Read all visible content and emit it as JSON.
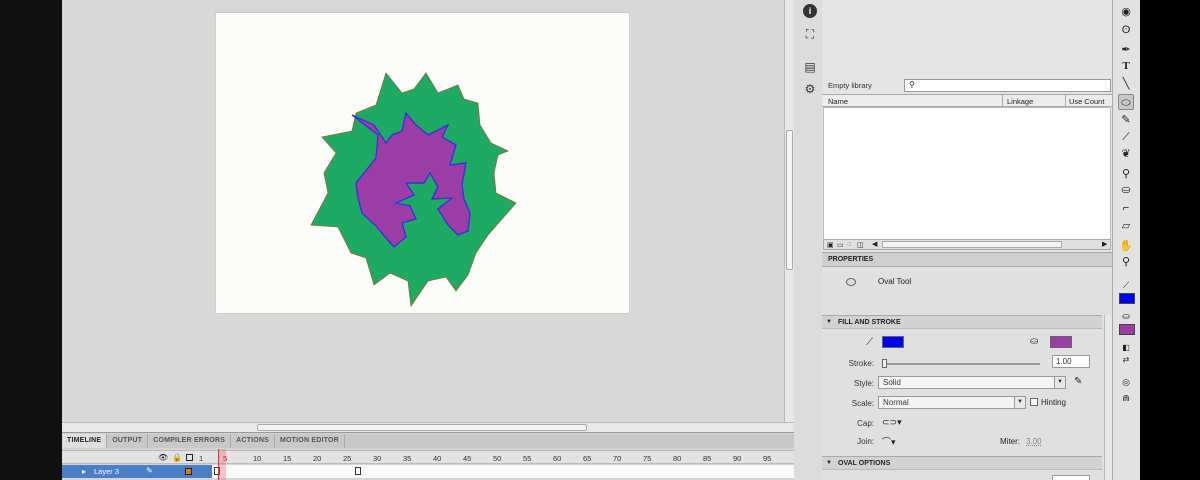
{
  "library": {
    "title": "Empty library",
    "search_value": "",
    "columns": [
      "Name",
      "Linkage",
      "Use Count"
    ]
  },
  "properties": {
    "tab_label": "PROPERTIES",
    "tool_name": "Oval Tool",
    "fill_stroke": {
      "title": "FILL AND STROKE",
      "stroke_color": "#0000ee",
      "fill_color": "#9a3ea3",
      "stroke_label": "Stroke:",
      "stroke_value": "1.00",
      "style_label": "Style:",
      "style_value": "Solid",
      "scale_label": "Scale:",
      "scale_value": "Normal",
      "hinting_label": "Hinting",
      "cap_label": "Cap:",
      "join_label": "Join:",
      "miter_label": "Miter:",
      "miter_value": "3.00"
    },
    "oval_options": {
      "title": "OVAL OPTIONS"
    }
  },
  "timeline": {
    "tabs": [
      "TIMELINE",
      "OUTPUT",
      "COMPILER ERRORS",
      "ACTIONS",
      "MOTION EDITOR"
    ],
    "frame_numbers": [
      "1",
      "5",
      "10",
      "15",
      "20",
      "25",
      "30",
      "35",
      "40",
      "45",
      "50",
      "55",
      "60",
      "65",
      "70",
      "75",
      "80",
      "85",
      "90",
      "95"
    ],
    "layer_name": "Layer 3",
    "current_frame": 5
  },
  "colors": {
    "shape_green": "#1faa63",
    "shape_purple": "#9a3ea3",
    "stroke_blue": "#3a2ee0",
    "toolbar_stroke": "#0000ee",
    "toolbar_fill": "#9a3ea3"
  },
  "icons": {
    "panel": [
      "info-icon",
      "transform-icon",
      "align-icon",
      "components-icon"
    ],
    "tools": [
      "3d-rotation-icon",
      "lasso-icon",
      "pen-icon",
      "text-icon",
      "line-icon",
      "oval-icon",
      "pencil-icon",
      "brush-icon",
      "deco-icon",
      "bone-icon",
      "paint-bucket-icon",
      "eyedropper-icon",
      "eraser-icon",
      "hand-icon",
      "zoom-icon"
    ]
  }
}
